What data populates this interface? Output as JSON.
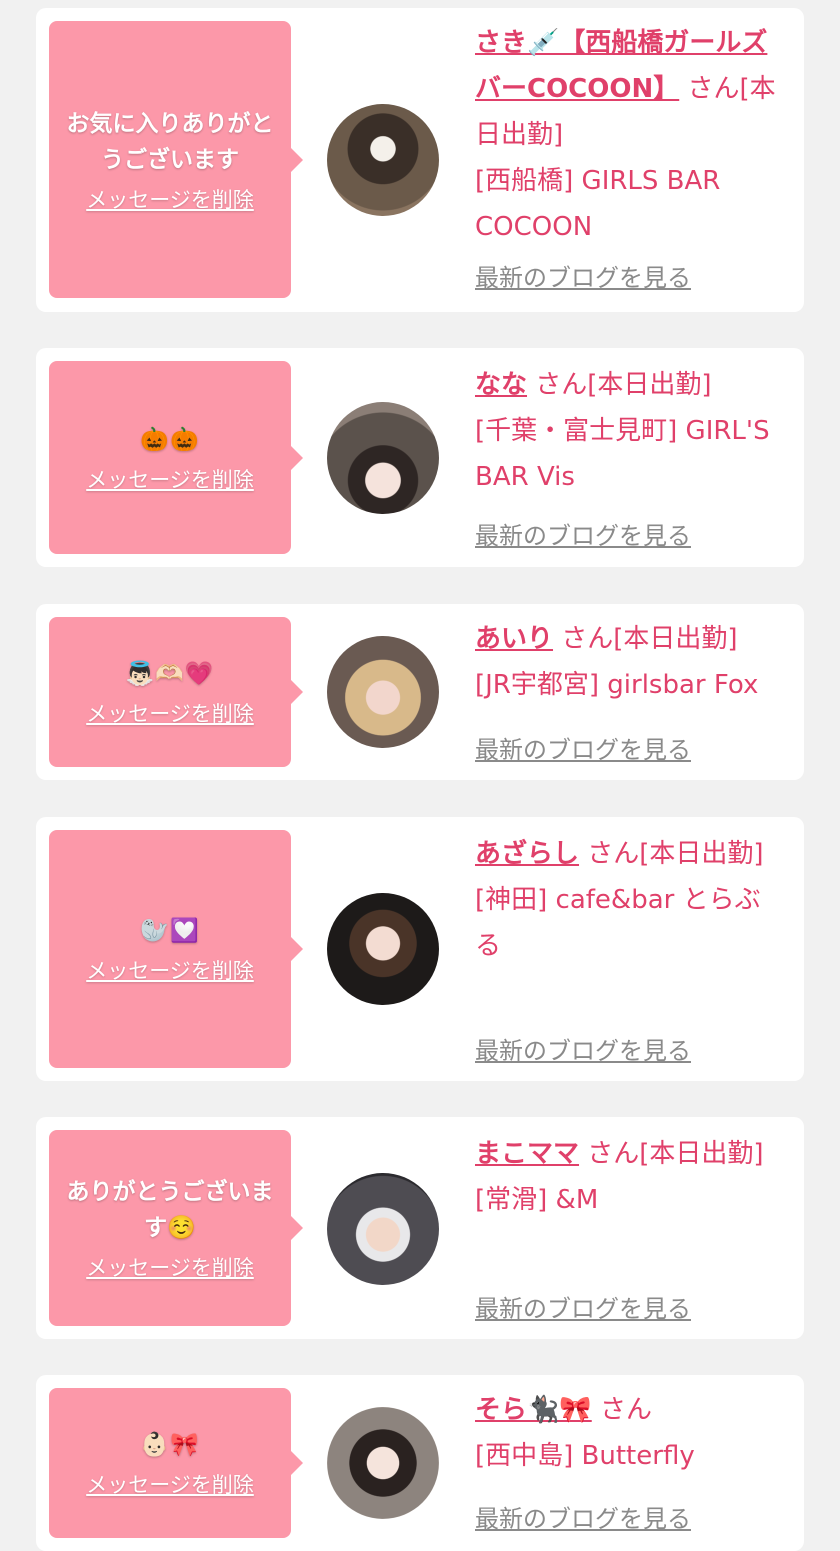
{
  "delete_label": "メッセージを削除",
  "blog_label": "最新のブログを見る",
  "colors": {
    "bubble": "#fc98a9",
    "accent": "#e0406a",
    "link_gray": "#8a8a8a",
    "background": "#f1f1f1"
  },
  "cards": [
    {
      "message": "お気に入りありがとうございます",
      "name": "さき💉【西船橋ガールズバーCOCOON】",
      "suffix": "さん[本日出勤]",
      "shop": "[西船橋] GIRLS BAR COCOON",
      "avatar_icon": "user-photo"
    },
    {
      "message": "🎃🎃",
      "name": "なな",
      "suffix": "さん[本日出勤]",
      "shop": "[千葉・富士見町] GIRL'S BAR Vis",
      "avatar_icon": "user-photo"
    },
    {
      "message": "👼🏻🫶🏻💗",
      "name": "あいり",
      "suffix": "さん[本日出勤]",
      "shop": "[JR宇都宮] girlsbar Fox",
      "avatar_icon": "user-photo"
    },
    {
      "message": "🦭💟",
      "name": "あざらし",
      "suffix": "さん[本日出勤]",
      "shop": "[神田] cafe&bar とらぶる",
      "avatar_icon": "user-photo"
    },
    {
      "message": "ありがとうございます☺️",
      "name": "まこママ",
      "suffix": "さん[本日出勤]",
      "shop": "[常滑] &M",
      "avatar_icon": "user-photo"
    },
    {
      "message": "👶🏻🎀",
      "name": "そら🐈‍⬛🎀",
      "suffix": "さん",
      "shop": "[西中島] Butterfly",
      "avatar_icon": "user-photo"
    }
  ]
}
